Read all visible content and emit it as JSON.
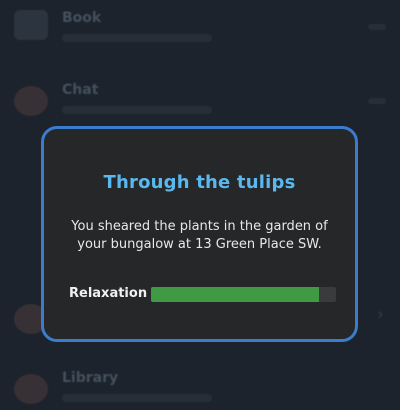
{
  "background": {
    "rows": [
      {
        "title": "Book"
      },
      {
        "title": "Chat"
      },
      {
        "title": ""
      },
      {
        "title": ""
      },
      {
        "title": ""
      },
      {
        "title": "Library"
      }
    ]
  },
  "dialog": {
    "title": "Through the tulips",
    "message": "You sheared the plants in the garden of your bungalow at 13 Green Place SW.",
    "stat": {
      "label": "Relaxation",
      "value": 0.91
    }
  },
  "colors": {
    "accent_border": "#3c7ccc",
    "title": "#5bb8ee",
    "bar_fill": "#3f9a43"
  }
}
